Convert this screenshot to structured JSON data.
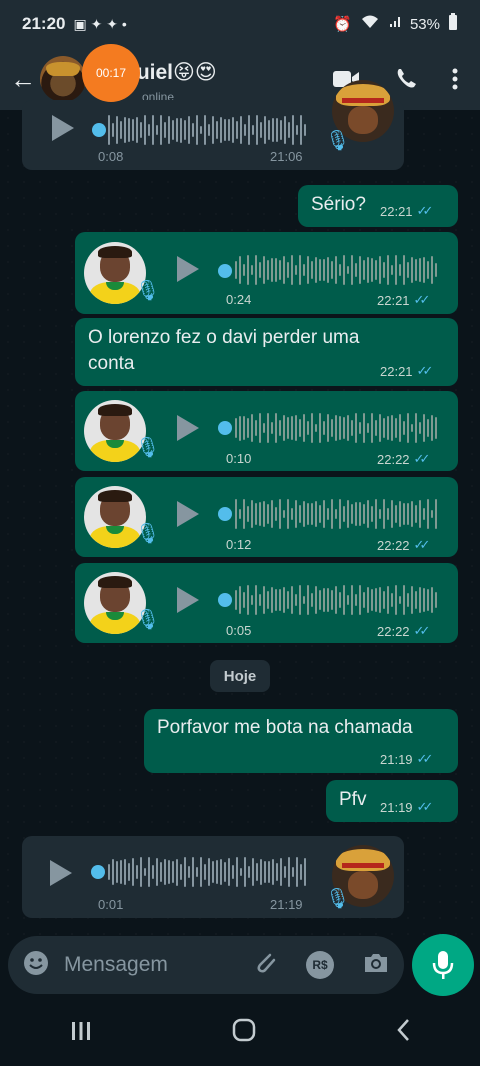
{
  "statusbar": {
    "time": "21:20",
    "battery": "53%"
  },
  "header": {
    "contact_name": "quiel😝😍",
    "contact_status": "online",
    "call_timer": "00:17"
  },
  "messages": [
    {
      "type": "audio",
      "direction": "in",
      "duration": "0:08",
      "time": "21:06"
    },
    {
      "type": "text",
      "direction": "out",
      "text": "Sério?",
      "time": "22:21"
    },
    {
      "type": "audio",
      "direction": "out",
      "duration": "0:24",
      "time": "22:21"
    },
    {
      "type": "text",
      "direction": "out",
      "text": "O lorenzo fez o davi perder uma conta",
      "time": "22:21"
    },
    {
      "type": "audio",
      "direction": "out",
      "duration": "0:10",
      "time": "22:22"
    },
    {
      "type": "audio",
      "direction": "out",
      "duration": "0:12",
      "time": "22:22"
    },
    {
      "type": "audio",
      "direction": "out",
      "duration": "0:05",
      "time": "22:22"
    },
    {
      "type": "date",
      "text": "Hoje"
    },
    {
      "type": "text",
      "direction": "out",
      "text": "Porfavor me bota na chamada",
      "time": "21:19"
    },
    {
      "type": "text",
      "direction": "out",
      "text": "Pfv",
      "time": "21:19"
    },
    {
      "type": "audio",
      "direction": "in",
      "duration": "0:01",
      "time": "21:19"
    }
  ],
  "input": {
    "placeholder": "Mensagem",
    "pix_label": "R$"
  },
  "colors": {
    "outgoing": "#005c4b",
    "incoming": "#1f2c34",
    "accent": "#00a884",
    "read_ticks": "#53bdeb"
  }
}
